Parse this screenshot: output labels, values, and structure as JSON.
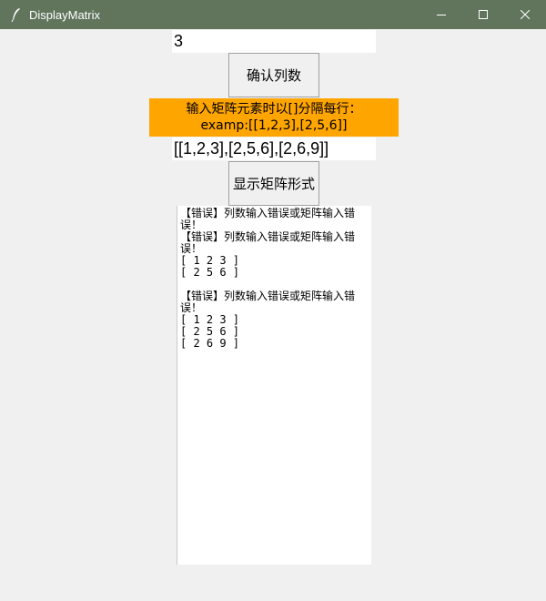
{
  "window": {
    "title": "DisplayMatrix",
    "icons": {
      "app": "feather-icon",
      "minimize": "minimize-icon",
      "maximize": "maximize-icon",
      "close": "close-icon"
    }
  },
  "columns_input": {
    "value": "3"
  },
  "confirm_button": {
    "label": "确认列数"
  },
  "instruction": {
    "line1": "输入矩阵元素时以[]分隔每行：",
    "line2": "examp:[[1,2,3],[2,5,6]]"
  },
  "matrix_input": {
    "value": "[[1,2,3],[2,5,6],[2,6,9]]"
  },
  "show_button": {
    "label": "显示矩阵形式"
  },
  "output": {
    "lines": [
      "【错误】列数输入错误或矩阵输入错误！",
      "【错误】列数输入错误或矩阵输入错误！",
      "[ 1 2 3 ]",
      "[ 2 5 6 ]",
      "",
      "【错误】列数输入错误或矩阵输入错误！",
      "[ 1 2 3 ]",
      "[ 2 5 6 ]",
      "[ 2 6 9 ]"
    ]
  },
  "colors": {
    "titlebar": "#61755c",
    "instruction_bg": "#ffa500",
    "window_bg": "#f0f0f0"
  }
}
